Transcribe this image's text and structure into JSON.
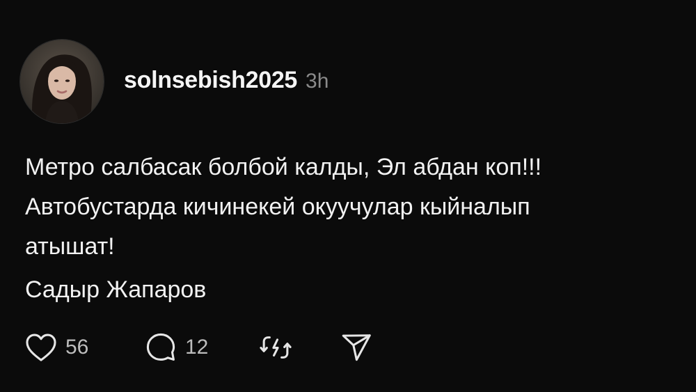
{
  "post": {
    "author": {
      "username": "solnsebish2025",
      "time": "3h"
    },
    "lines": [
      "Метро салбасак болбой калды,  Эл абдан коп!!!",
      "Автобустарда кичинекей окуучулар кыйналып",
      "атышат!"
    ],
    "signature": "Садыр Жапаров",
    "actions": {
      "likes": "56",
      "replies": "12"
    }
  },
  "icons": {
    "like": "heart-icon",
    "reply": "comment-icon",
    "repost": "repost-icon",
    "share": "share-icon"
  },
  "colors": {
    "background": "#0b0b0b",
    "text": "#f2f2f2",
    "muted": "#8a8a8a"
  }
}
